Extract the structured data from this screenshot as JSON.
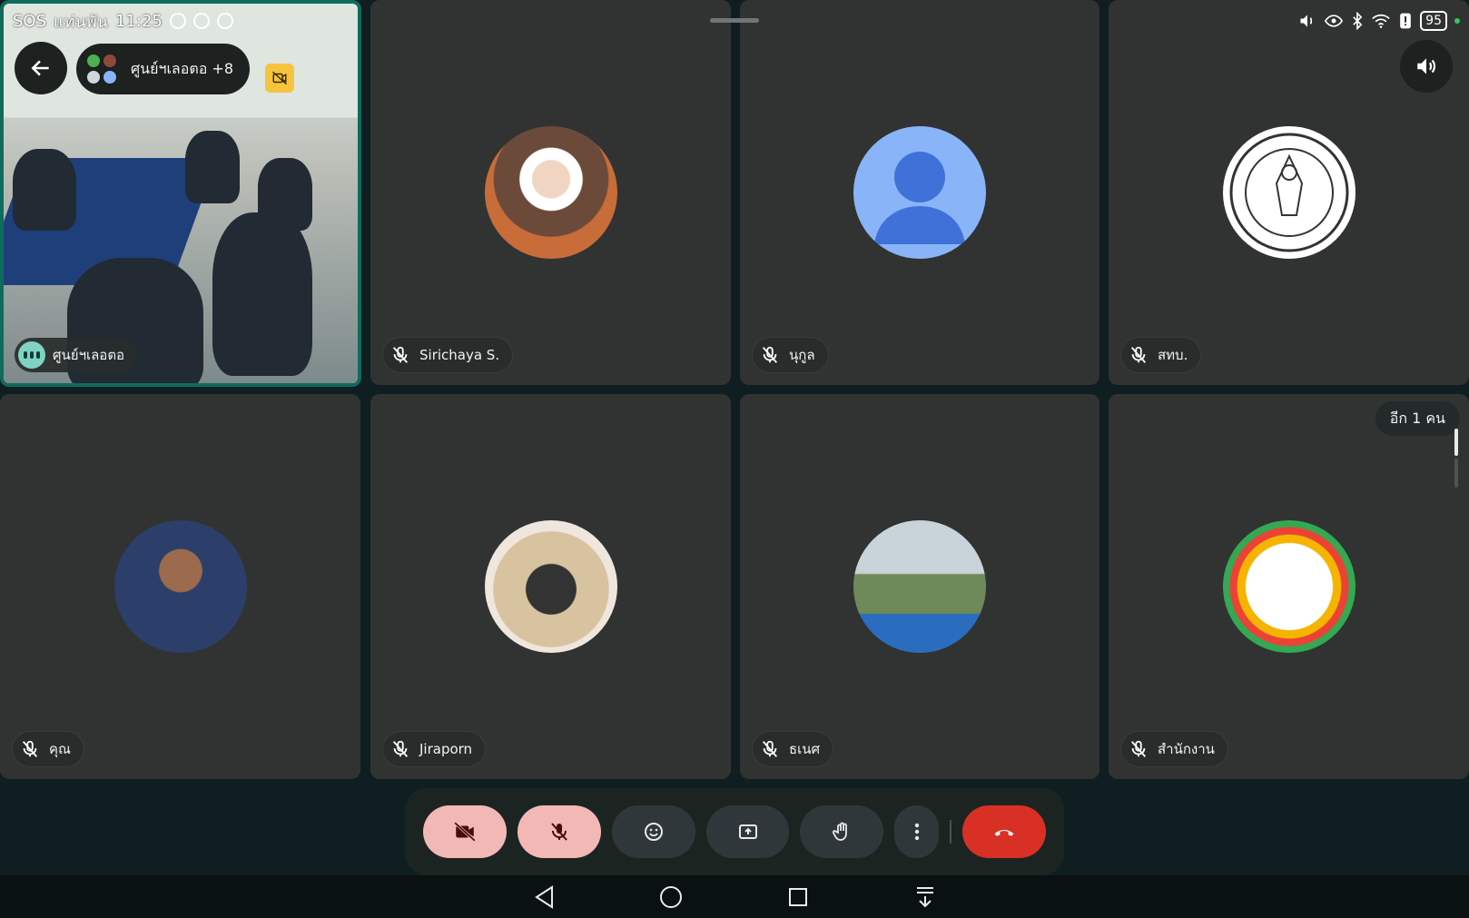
{
  "status_bar": {
    "carrier": "SOS",
    "operator": "แท่นพัน",
    "time": "11:25",
    "battery": "95"
  },
  "featured": {
    "room_label": "ศูนย์ฯเลอตอ +8",
    "speaker_name": "ศูนย์ฯเลอตอ"
  },
  "participants": [
    {
      "name": "Sirichaya S."
    },
    {
      "name": "นุกูล"
    },
    {
      "name": "สทบ."
    },
    {
      "name": "คุณ"
    },
    {
      "name": "Jiraporn"
    },
    {
      "name": "ธเนศ"
    },
    {
      "name": "สำนักงาน"
    }
  ],
  "more_people": "อีก 1 คน",
  "colors": {
    "accent_border": "#0f6b5c",
    "end_call": "#d93025",
    "muted_button": "#f2b8b5",
    "warning": "#f6c43c"
  },
  "icons": {
    "back": "arrow-left-icon",
    "volume": "speaker-icon",
    "camera_off": "video-off-icon",
    "mic_off": "mic-off-icon",
    "reactions": "emoji-icon",
    "present": "present-screen-icon",
    "raise_hand": "hand-icon",
    "more": "more-vert-icon",
    "end_call": "call-end-icon"
  }
}
